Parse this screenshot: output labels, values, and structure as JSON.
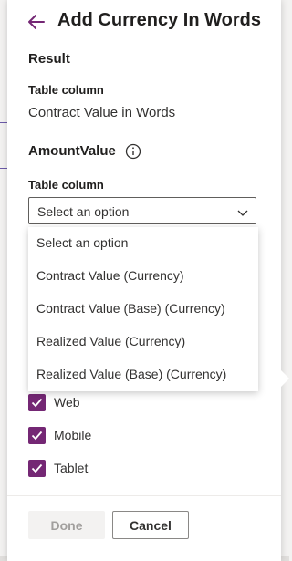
{
  "panel": {
    "title": "Add Currency In Words",
    "back_icon": "back-arrow-icon",
    "accent_color": "#742774"
  },
  "result": {
    "section_title": "Result",
    "column_label": "Table column",
    "column_value": "Contract Value in Words"
  },
  "amount": {
    "section_title": "AmountValue",
    "info_icon": "info-icon",
    "column_label": "Table column",
    "select_value": "Select an option",
    "options": [
      "Select an option",
      "Contract Value (Currency)",
      "Contract Value (Base) (Currency)",
      "Realized Value (Currency)",
      "Realized Value (Base) (Currency)"
    ]
  },
  "devices": [
    {
      "label": "Web",
      "checked": true
    },
    {
      "label": "Mobile",
      "checked": true
    },
    {
      "label": "Tablet",
      "checked": true
    }
  ],
  "footer": {
    "done_label": "Done",
    "cancel_label": "Cancel"
  }
}
